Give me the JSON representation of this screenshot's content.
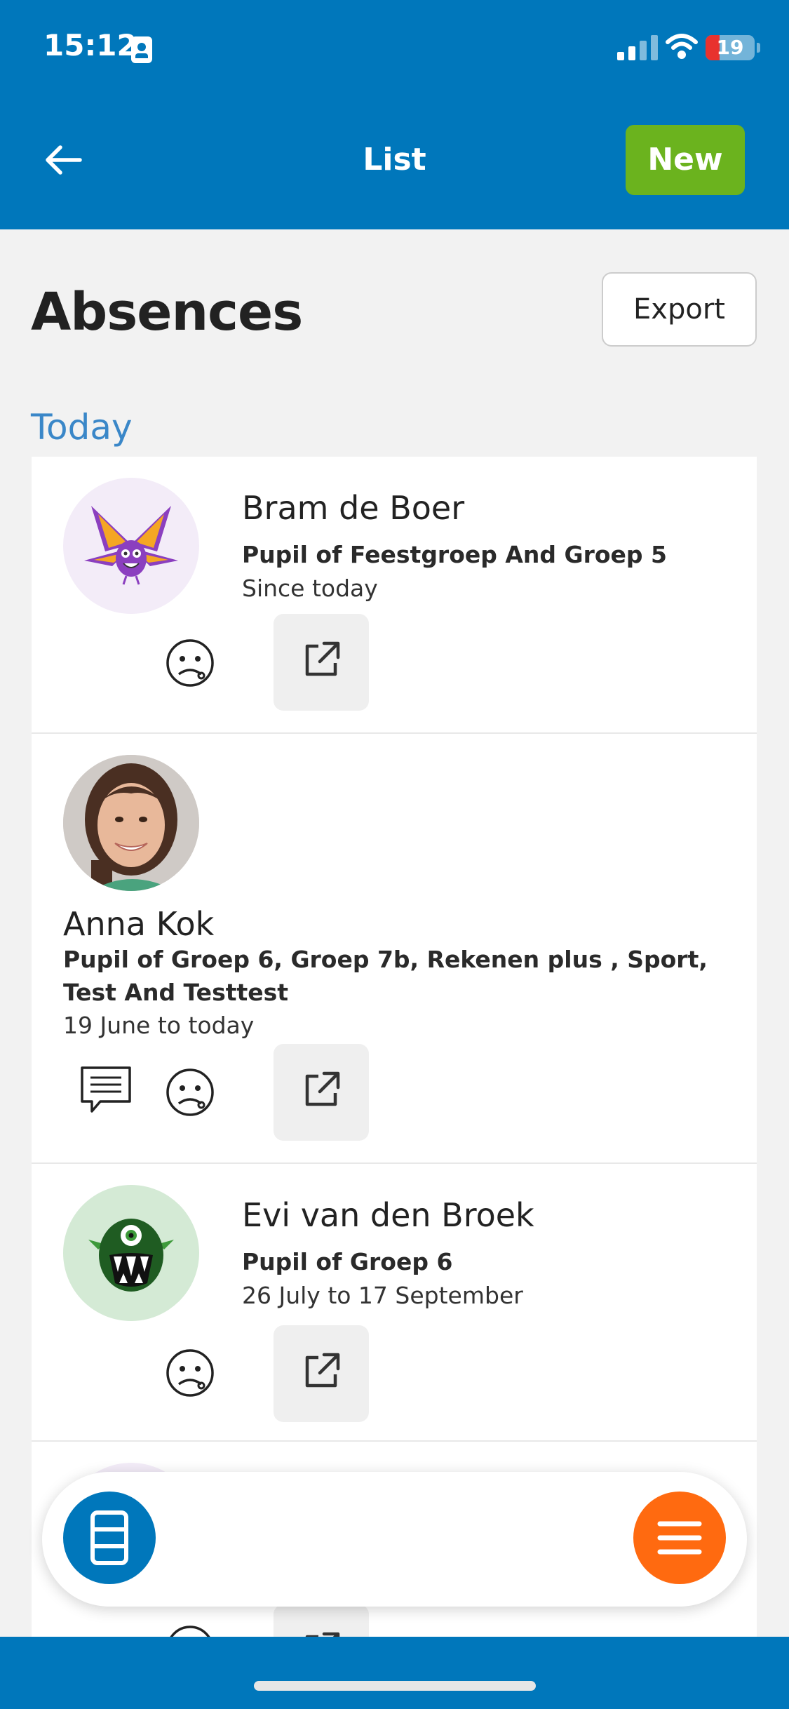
{
  "status_bar": {
    "time": "15:12",
    "battery": "19"
  },
  "nav": {
    "title": "List",
    "new_label": "New"
  },
  "page": {
    "title": "Absences",
    "export_label": "Export"
  },
  "section": {
    "label": "Today"
  },
  "absences": [
    {
      "name": "Bram de Boer",
      "groups": "Pupil of Feestgroep And Groep 5",
      "period": "Since today",
      "avatar": "purple-bat-monster"
    },
    {
      "name": "Anna Kok",
      "groups": "Pupil of Groep 6, Groep 7b, Rekenen plus , Sport, Test And Testtest",
      "period": "19 June to today",
      "avatar": "photo"
    },
    {
      "name": "Evi van den Broek",
      "groups": "Pupil of Groep 6",
      "period": "26 July to 17 September",
      "avatar": "green-one-eyed-monster"
    }
  ],
  "colors": {
    "primary": "#0077bb",
    "new_button": "#6bb31e",
    "menu_button": "#ff6a10",
    "section_label": "#3a87c8"
  }
}
